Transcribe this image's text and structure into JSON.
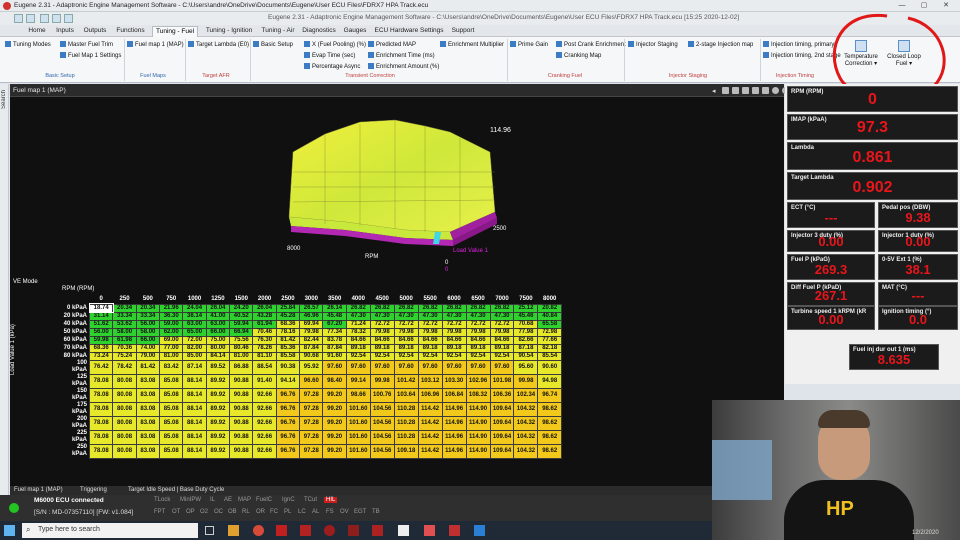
{
  "app": {
    "window_title": "Eugene 2.31 - Adaptronic Engine Management Software - C:\\Users\\andre\\OneDrive\\Documents\\Eugene\\User ECU Files\\FDRX7 HPA Track.ecu",
    "inner_title": "Eugene 2.31 - Adaptronic Engine Management Software - C:\\Users\\andre\\OneDrive\\Documents\\Eugene\\User ECU Files\\FDRX7 HPA Track.ecu   [15:25  2020-12-02]"
  },
  "tabs": [
    "Home",
    "Inputs",
    "Outputs",
    "Functions",
    "Tuning - Fuel",
    "Tuning - Ignition",
    "Tuning - Air",
    "Diagnostics",
    "Gauges",
    "ECU Hardware Settings",
    "Support"
  ],
  "active_tab": "Tuning - Fuel",
  "ribbon": {
    "basic": [
      "Tuning Modes",
      "Master Fuel Trim",
      "Fuel Map 1 Settings"
    ],
    "fuelmaps": [
      "Fuel map 1 (MAP)"
    ],
    "targetafr": [
      "Target Lambda (E0)"
    ],
    "transient": [
      "Basic Setup",
      "X (Fuel Pooling) (%)",
      "Evap Time (sec)",
      "Percentage Async",
      "Predicted MAP",
      "Enrichment Time (ms)",
      "Enrichment Amount (%)",
      "Enrichment Multiplier"
    ],
    "cranking": [
      "Prime Gain",
      "Post Crank Enrichment",
      "Cranking Map"
    ],
    "injstaging": [
      "Injector Staging",
      "2-stage Injection map"
    ],
    "injtiming": [
      "Injection timing, primary",
      "Injection timing, 2nd stage"
    ],
    "temp_correction": "Temperature Correction",
    "closed_loop": "Closed Loop Fuel",
    "groups": [
      "Basic Setup",
      "Fuel Maps",
      "Target AFR",
      "Transient Correction",
      "Cranking Fuel",
      "Injector Staging",
      "Injection Timing"
    ]
  },
  "panel": {
    "title": "Fuel map 1 (MAP)",
    "ve_mode": "VE Mode",
    "rpm_label": "RPM (RPM)",
    "y_axis": "Load Value 1 (kPa)",
    "surface": {
      "max": "114.96",
      "x_min": "8000",
      "x_label": "RPM",
      "y_val": "2500",
      "y_label": "Load Value 1",
      "z0": "0",
      "z1": "0"
    }
  },
  "fuel_table": {
    "rpm": [
      "0",
      "250",
      "500",
      "750",
      "1000",
      "1250",
      "1500",
      "2000",
      "2500",
      "3000",
      "3500",
      "4000",
      "4500",
      "5000",
      "5500",
      "6000",
      "6500",
      "7000",
      "7500",
      "8000"
    ],
    "load": [
      "0 kPaA",
      "20 kPaA",
      "40 kPaA",
      "50 kPaA",
      "60 kPaA",
      "70 kPaA",
      "80 kPaA",
      "100 kPaA",
      "125 kPaA",
      "150 kPaA",
      "175 kPaA",
      "200 kPaA",
      "225 kPaA",
      "250 kPaA"
    ],
    "rows": [
      [
        "18.74",
        "20.34",
        "20.34",
        "21.96",
        "24.04",
        "26.04",
        "24.20",
        "26.04",
        "25.84",
        "26.57",
        "26.14",
        "26.82",
        "26.82",
        "26.82",
        "26.82",
        "26.82",
        "26.82",
        "26.82",
        "25.12",
        "20.82"
      ],
      [
        "31.14",
        "33.34",
        "33.34",
        "36.30",
        "38.14",
        "41.00",
        "40.52",
        "43.28",
        "45.28",
        "46.96",
        "45.48",
        "47.30",
        "47.30",
        "47.30",
        "47.30",
        "47.30",
        "47.30",
        "47.30",
        "45.46",
        "40.84"
      ],
      [
        "51.62",
        "53.62",
        "56.00",
        "59.00",
        "63.00",
        "63.00",
        "59.94",
        "61.94",
        "68.36",
        "69.94",
        "67.20",
        "71.24",
        "72.72",
        "72.72",
        "72.72",
        "72.72",
        "72.72",
        "72.72",
        "70.68",
        "65.58"
      ],
      [
        "56.00",
        "58.00",
        "58.00",
        "62.00",
        "65.00",
        "66.00",
        "66.94",
        "70.46",
        "78.16",
        "79.98",
        "77.34",
        "78.32",
        "79.98",
        "79.98",
        "79.98",
        "79.98",
        "79.98",
        "79.98",
        "77.98",
        "72.98"
      ],
      [
        "59.98",
        "61.98",
        "66.00",
        "69.00",
        "72.00",
        "75.00",
        "75.56",
        "76.30",
        "81.42",
        "82.44",
        "83.78",
        "84.66",
        "84.66",
        "84.66",
        "84.66",
        "84.66",
        "84.66",
        "84.66",
        "82.66",
        "77.66"
      ],
      [
        "68.36",
        "70.36",
        "74.00",
        "77.00",
        "82.00",
        "80.00",
        "80.46",
        "78.26",
        "85.36",
        "87.84",
        "87.84",
        "89.18",
        "89.18",
        "89.18",
        "89.18",
        "89.18",
        "89.18",
        "89.18",
        "87.18",
        "82.18"
      ],
      [
        "73.24",
        "75.24",
        "79.00",
        "81.00",
        "85.00",
        "84.14",
        "81.00",
        "81.10",
        "85.58",
        "90.68",
        "91.60",
        "92.54",
        "92.54",
        "92.54",
        "92.54",
        "92.54",
        "92.54",
        "92.54",
        "90.54",
        "85.54"
      ],
      [
        "76.42",
        "78.42",
        "81.42",
        "83.42",
        "87.14",
        "89.52",
        "86.88",
        "88.54",
        "90.38",
        "95.92",
        "97.60",
        "97.60",
        "97.60",
        "97.60",
        "97.60",
        "97.60",
        "97.60",
        "97.60",
        "95.60",
        "90.60"
      ],
      [
        "78.08",
        "80.08",
        "83.08",
        "85.08",
        "88.14",
        "89.92",
        "90.88",
        "91.40",
        "94.14",
        "96.60",
        "98.40",
        "99.14",
        "99.98",
        "101.42",
        "103.12",
        "103.30",
        "102.96",
        "101.98",
        "99.98",
        "94.98"
      ],
      [
        "78.08",
        "80.08",
        "83.08",
        "85.08",
        "88.14",
        "89.92",
        "90.88",
        "92.66",
        "96.76",
        "97.28",
        "99.20",
        "98.66",
        "100.76",
        "103.64",
        "106.96",
        "106.84",
        "108.32",
        "106.36",
        "102.34",
        "96.74"
      ],
      [
        "78.08",
        "80.08",
        "83.08",
        "85.08",
        "88.14",
        "89.92",
        "90.88",
        "92.66",
        "96.76",
        "97.28",
        "99.20",
        "101.60",
        "104.56",
        "110.28",
        "114.42",
        "114.96",
        "114.90",
        "109.64",
        "104.32",
        "98.62"
      ],
      [
        "78.08",
        "80.08",
        "83.08",
        "85.08",
        "88.14",
        "89.92",
        "90.88",
        "92.66",
        "96.76",
        "97.28",
        "99.20",
        "101.60",
        "104.56",
        "110.28",
        "114.42",
        "114.96",
        "114.90",
        "109.64",
        "104.32",
        "98.62"
      ],
      [
        "78.08",
        "80.08",
        "83.08",
        "85.08",
        "88.14",
        "89.92",
        "90.88",
        "92.66",
        "96.76",
        "97.28",
        "99.20",
        "101.60",
        "104.56",
        "110.28",
        "114.42",
        "114.96",
        "114.90",
        "109.64",
        "104.32",
        "98.62"
      ],
      [
        "78.08",
        "80.08",
        "83.08",
        "85.08",
        "88.14",
        "89.92",
        "90.88",
        "92.66",
        "96.76",
        "97.28",
        "99.20",
        "101.60",
        "104.56",
        "109.18",
        "114.42",
        "114.96",
        "114.90",
        "109.64",
        "104.32",
        "98.62"
      ]
    ],
    "colors": {
      "low": "#2ed12e",
      "mid": "#e8e82a",
      "high": "#f2c91a"
    }
  },
  "gauges": [
    {
      "label": "RPM (RPM)",
      "value": "0"
    },
    {
      "label": "IMAP (kPaA)",
      "value": "97.3"
    },
    {
      "label": "Lambda",
      "value": "0.861"
    },
    {
      "label": "Target Lambda",
      "value": "0.902"
    },
    {
      "label": "ECT (°C)",
      "value": "---"
    },
    {
      "label": "Pedal pos (DBW)",
      "value": "9.38"
    },
    {
      "label": "Injector 3 duty (%)",
      "value": "0.00"
    },
    {
      "label": "Injector 1 duty (%)",
      "value": "0.00"
    },
    {
      "label": "Fuel P (kPaG)",
      "value": "269.3"
    },
    {
      "label": "0-5V Ext 1 (%)",
      "value": "38.1"
    },
    {
      "label": "Diff Fuel P (kPaD)",
      "value": "267.1"
    },
    {
      "label": "MAT (°C)",
      "value": "---"
    },
    {
      "label": "Turbine speed 1 kRPM (kR",
      "value": "0.00"
    },
    {
      "label": "Ignition timing (°)",
      "value": "0.0"
    },
    {
      "label": "Fuel inj dur out 1 (ms)",
      "value": "8.635"
    }
  ],
  "bottom_tabs": [
    "Fuel map 1 (MAP)",
    "Triggering",
    "Target Idle Speed | Base Duty Cycle"
  ],
  "status": {
    "ecu": "M6000 ECU connected",
    "serial": "[S/N : MD-07357110] [FW: v1.084]",
    "flags1": [
      "TLock",
      "MinIPW",
      "IL",
      "AE",
      "MAP",
      "FuelC",
      "IgnC",
      "TCut",
      "HIL"
    ],
    "flags2": [
      "FPT",
      "OT",
      "OP",
      "O2",
      "OC",
      "OB",
      "RL",
      "OR",
      "FC",
      "PL",
      "LC",
      "AL",
      "FS",
      "OV",
      "EGT",
      "TB"
    ]
  },
  "taskbar": {
    "search_placeholder": "Type here to search",
    "date": "12/2/2020"
  },
  "webcam": {
    "shirt_text": "HP"
  }
}
